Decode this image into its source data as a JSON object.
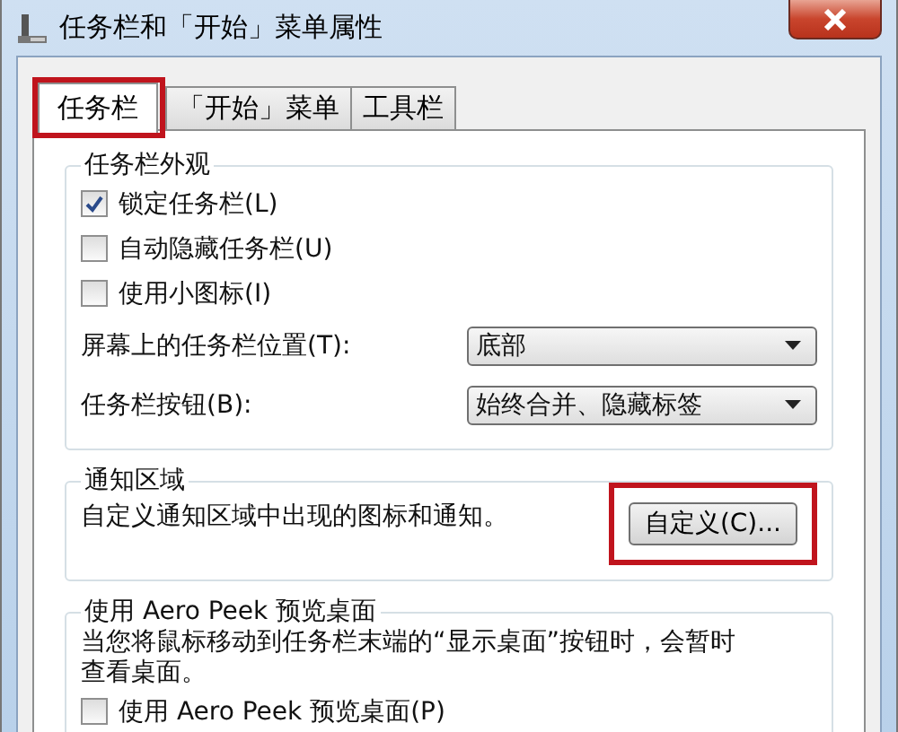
{
  "window": {
    "title": "任务栏和「开始」菜单属性"
  },
  "tabs": [
    {
      "label": "任务栏",
      "selected": true,
      "highlighted": true
    },
    {
      "label": "「开始」菜单",
      "selected": false,
      "highlighted": false
    },
    {
      "label": "工具栏",
      "selected": false,
      "highlighted": false
    }
  ],
  "appearance": {
    "title": "任务栏外观",
    "options": [
      {
        "label": "锁定任务栏(L)",
        "checked": true
      },
      {
        "label": "自动隐藏任务栏(U)",
        "checked": false
      },
      {
        "label": "使用小图标(I)",
        "checked": false
      }
    ],
    "selects": [
      {
        "label": "屏幕上的任务栏位置(T):",
        "value": "底部"
      },
      {
        "label": "任务栏按钮(B):",
        "value": "始终合并、隐藏标签"
      }
    ]
  },
  "notification": {
    "title": "通知区域",
    "text": "自定义通知区域中出现的图标和通知。",
    "button": "自定义(C)...",
    "button_highlighted": true
  },
  "peek": {
    "title": "使用 Aero Peek 预览桌面",
    "text": "当您将鼠标移动到任务栏末端的“显示桌面”按钮时，会暂时查看桌面。",
    "option": {
      "label": "使用 Aero Peek 预览桌面(P)",
      "checked": false
    }
  }
}
